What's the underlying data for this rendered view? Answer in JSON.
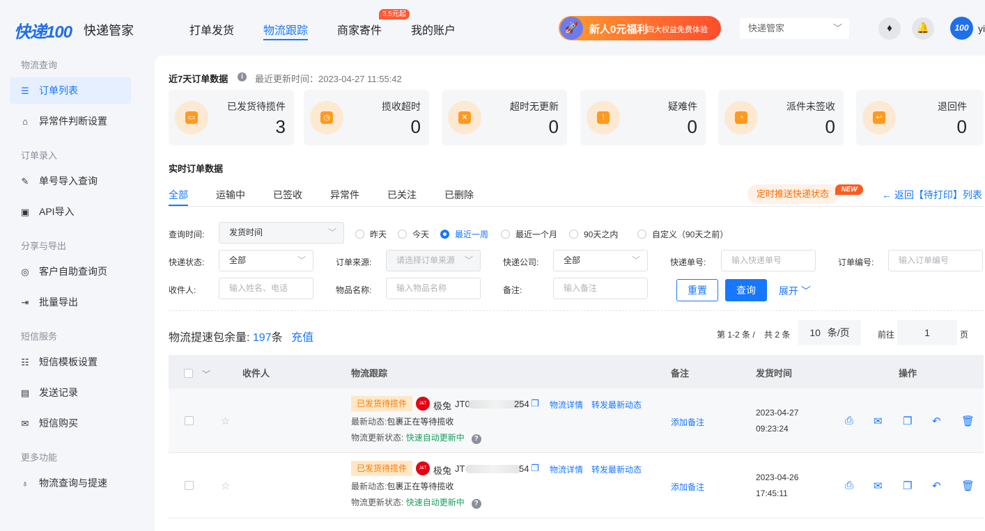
{
  "header": {
    "logo": "快递100",
    "title": "快递管家",
    "nav": [
      "打单发货",
      "物流跟踪",
      "商家寄件",
      "我的账户"
    ],
    "nav_badge": "3.5元起",
    "promo_main": "新人0元福利",
    "promo_sub": "四大权益免费体验",
    "select_value": "快递管家",
    "avatar_text": "100",
    "username": "yi"
  },
  "sidebar": {
    "groups": [
      "物流查询",
      "订单录入",
      "分享与导出",
      "短信服务",
      "更多功能"
    ],
    "items": [
      "订单列表",
      "异常件判断设置",
      "单号导入查询",
      "API导入",
      "客户自助查询页",
      "批量导出",
      "短信模板设置",
      "发送记录",
      "短信购买",
      "物流查询与提速"
    ]
  },
  "stats": {
    "title": "近7天订单数据",
    "updated": "最近更新时间：2023-04-27 11:55:42",
    "cards": [
      {
        "label": "已发货待揽件",
        "value": "3"
      },
      {
        "label": "揽收超时",
        "value": "0"
      },
      {
        "label": "超时无更新",
        "value": "0"
      },
      {
        "label": "疑难件",
        "value": "0"
      },
      {
        "label": "派件未签收",
        "value": "0"
      },
      {
        "label": "退回件",
        "value": "0"
      }
    ]
  },
  "realtime": {
    "title": "实时订单数据",
    "tabs": [
      "全部",
      "运输中",
      "已签收",
      "异常件",
      "已关注",
      "已删除"
    ],
    "push_button": "定时推送快递状态",
    "new_badge": "NEW",
    "back_link": "← 返回【待打印】列表"
  },
  "filters": {
    "time_label": "查询时间:",
    "time_select": "发货时间",
    "radios": [
      "昨天",
      "今天",
      "最近一周",
      "最近一个月",
      "90天之内",
      "自定义（90天之前）"
    ],
    "status_label": "快递状态:",
    "status_value": "全部",
    "source_label": "订单来源:",
    "source_placeholder": "请选择订单来源",
    "company_label": "快递公司:",
    "company_value": "全部",
    "tracking_label": "快递单号:",
    "tracking_placeholder": "输入快递单号",
    "order_label": "订单编号:",
    "order_placeholder": "输入订单编号",
    "recipient_label": "收件人:",
    "recipient_placeholder": "输入姓名、电话",
    "item_label": "物品名称:",
    "item_placeholder": "输入物品名称",
    "note_label": "备注:",
    "note_placeholder": "输入备注",
    "reset": "重置",
    "query": "查询",
    "expand": "展开 ﹀"
  },
  "balance": {
    "label": "物流提速包余量:",
    "count": "197",
    "unit": "条",
    "recharge": "充值"
  },
  "pagination": {
    "range": "第 1-2 条 /",
    "total": "共 2 条",
    "page_size": "10",
    "per_page": "条/页",
    "goto": "前往",
    "page": "1",
    "page_unit": "页"
  },
  "table": {
    "columns": [
      "收件人",
      "物流跟踪",
      "备注",
      "发货时间",
      "操作"
    ],
    "rows": [
      {
        "status": "已发货待揽件",
        "courier": "极兔",
        "tracking_prefix": "JT0",
        "tracking_suffix": "254",
        "detail": "物流详情",
        "forward": "转发最新动态",
        "latest_label": "最新动态:",
        "latest": "包裹正在等待揽收",
        "update_label": "物流更新状态:",
        "update": "快速自动更新中",
        "note": "添加备注",
        "date": "2023-04-27",
        "time": "09:23:24"
      },
      {
        "status": "已发货待揽件",
        "courier": "极兔",
        "tracking_prefix": "JT",
        "tracking_suffix": "54",
        "detail": "物流详情",
        "forward": "转发最新动态",
        "latest_label": "最新动态:",
        "latest": "包裹正在等待揽收",
        "update_label": "物流更新状态:",
        "update": "快速自动更新中",
        "note": "添加备注",
        "date": "2023-04-26",
        "time": "17:45:11"
      }
    ]
  }
}
